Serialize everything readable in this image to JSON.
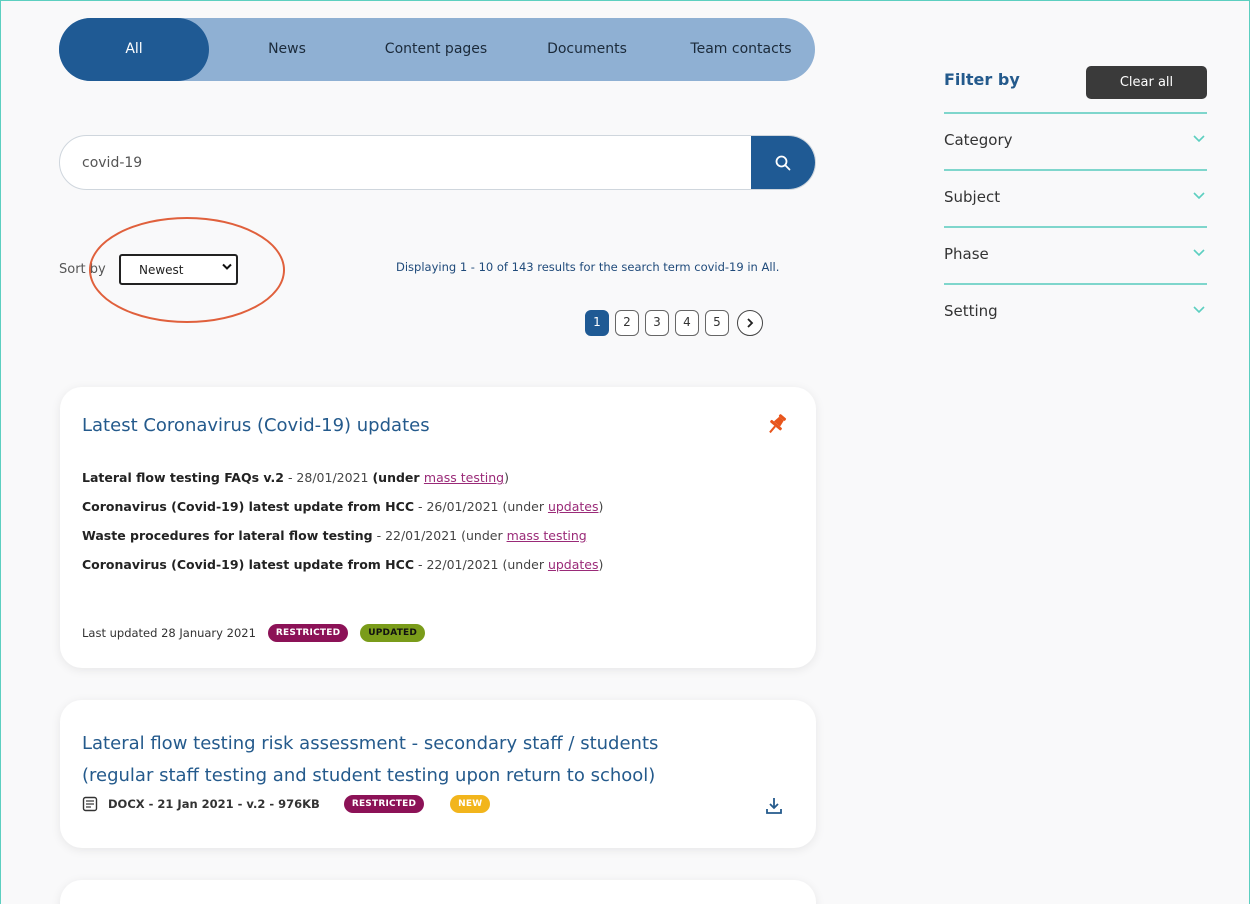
{
  "tabs": [
    {
      "label": "All",
      "active": true
    },
    {
      "label": "News"
    },
    {
      "label": "Content pages"
    },
    {
      "label": "Documents"
    },
    {
      "label": "Team contacts"
    }
  ],
  "search": {
    "value": "covid-19"
  },
  "sort": {
    "label": "Sort by",
    "selected": "Newest"
  },
  "results_info": "Displaying 1 - 10 of 143 results for the search term covid-19 in All.",
  "pagination": {
    "pages": [
      "1",
      "2",
      "3",
      "4",
      "5"
    ],
    "active": "1"
  },
  "cards": [
    {
      "title": "Latest Coronavirus (Covid-19) updates",
      "updates": [
        {
          "title": "Lateral flow testing FAQs v.2",
          "date": " - 28/01/2021 ",
          "under": "(under ",
          "link": "mass testing",
          "close": ")"
        },
        {
          "title": "Coronavirus (Covid-19) latest update from HCC",
          "date": " - 26/01/2021 ",
          "under": "(under ",
          "link": "updates",
          "close": ")"
        },
        {
          "title": "Waste procedures for lateral flow testing",
          "date": " - 22/01/2021 ",
          "under": "(under ",
          "link": "mass testing",
          "close": ""
        },
        {
          "title": "Coronavirus (Covid-19) latest update from HCC",
          "date": " - 22/01/2021 ",
          "under": "(under ",
          "link": "updates",
          "close": ")"
        }
      ],
      "last_updated": "Last updated 28 January 2021",
      "badges": [
        "RESTRICTED",
        "UPDATED"
      ]
    },
    {
      "title": "Lateral flow testing risk assessment - secondary staff / students (regular staff testing and student testing upon return to school)",
      "doc_meta": "DOCX - 21 Jan 2021 - v.2 - 976KB",
      "badges": [
        "RESTRICTED",
        "NEW"
      ]
    }
  ],
  "filter": {
    "title": "Filter by",
    "clear_label": "Clear all",
    "items": [
      "Category",
      "Subject",
      "Phase",
      "Setting"
    ]
  },
  "colors": {
    "primary": "#1f5a94",
    "tab_bar": "#8fb0d3",
    "accent_line": "#7fd6cc",
    "restricted": "#8c1257",
    "updated": "#7a9c1a",
    "new": "#f2b51c",
    "annotation": "#e0603c"
  }
}
